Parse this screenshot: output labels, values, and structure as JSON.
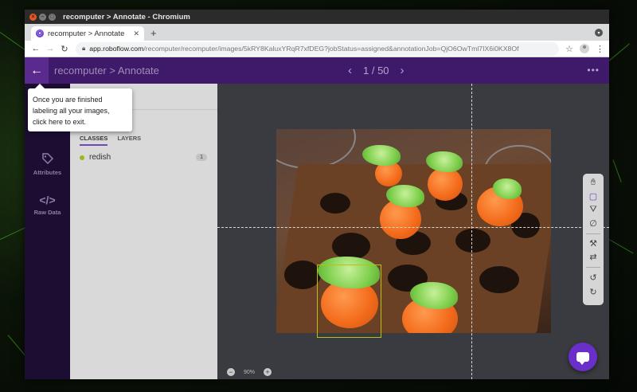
{
  "window": {
    "title": "recomputer > Annotate - Chromium"
  },
  "browser": {
    "tab_title": "recomputer > Annotate",
    "tab_favicon": "roboflow-icon",
    "url_host": "app.roboflow.com",
    "url_path": "/recomputer/recomputer/images/5kRY8KaluxYRqR7xfDEG?jobStatus=assigned&annotationJob=QjO6OwTml7IX6i0KX8Of"
  },
  "header": {
    "breadcrumb": "recomputer > Annotate",
    "page_indicator": "1 / 50"
  },
  "left_nav": {
    "items": [
      {
        "label": "Attributes",
        "icon": "tag-icon"
      },
      {
        "label": "Raw Data",
        "icon": "code-icon"
      }
    ]
  },
  "side_panel": {
    "tabs": [
      "CLASSES",
      "LAYERS"
    ],
    "active_tab": "CLASSES",
    "classes": [
      {
        "name": "redish",
        "count": "1",
        "color": "#9bb71e"
      }
    ]
  },
  "tooltip": {
    "lines": [
      "Once you are finished",
      "labeling all your images,",
      "click here to exit."
    ]
  },
  "zoom": {
    "value": "90%"
  },
  "colors": {
    "header_bg": "#3f1a6b",
    "accent": "#6b2fc9",
    "bbox": "#b8c20f"
  }
}
